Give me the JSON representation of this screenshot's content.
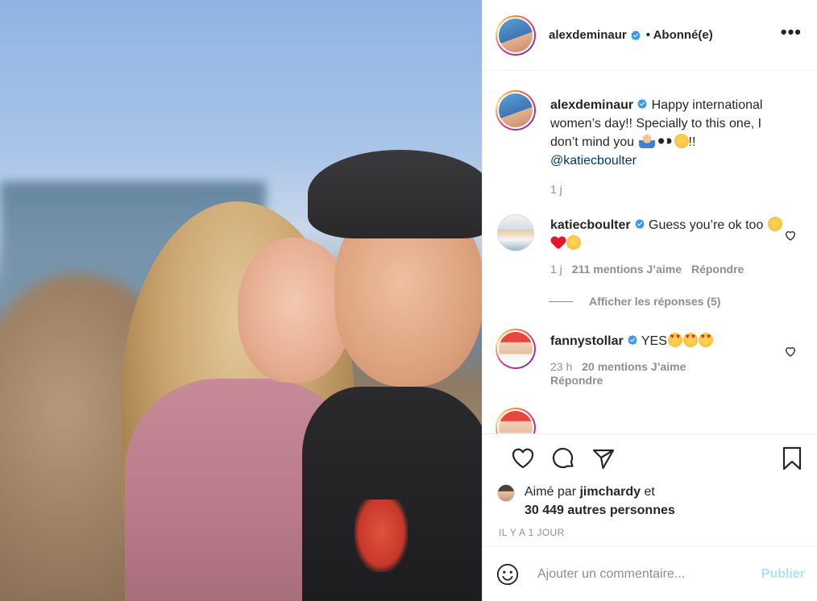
{
  "post": {
    "author": "alexdeminaur",
    "follow_status": "• Abonné(e)",
    "more_icon": "more-horizontal-icon",
    "caption_user": "alexdeminaur",
    "caption_text": "Happy international women’s day!! Specially to this one, I don’t mind you",
    "caption_suffix": "!!",
    "caption_mention": "@katiecboulter",
    "caption_time": "1 j"
  },
  "comments": [
    {
      "user": "katiecboulter",
      "text": "Guess you’re ok too",
      "time": "1 j",
      "likes": "211 mentions J’aime",
      "reply": "Répondre",
      "replies_label": "Afficher les réponses (5)"
    },
    {
      "user": "fannystollar",
      "text": "YES",
      "time": "23 h",
      "likes": "20 mentions J’aime",
      "reply": "Répondre"
    }
  ],
  "actions": {
    "liked_by_prefix": "Aimé par",
    "liked_by_user": "jimchardy",
    "liked_by_connector": "et",
    "liked_by_others": "30 449 autres personnes",
    "time_ago": "IL Y A 1 JOUR"
  },
  "add_comment": {
    "placeholder": "Ajouter un commentaire...",
    "publish_label": "Publier"
  },
  "colors": {
    "accent": "#0095f6",
    "publish_disabled": "#b2dffc",
    "mention": "#00376b",
    "muted_text": "#8e8e8e",
    "verified": "#3897f0"
  }
}
